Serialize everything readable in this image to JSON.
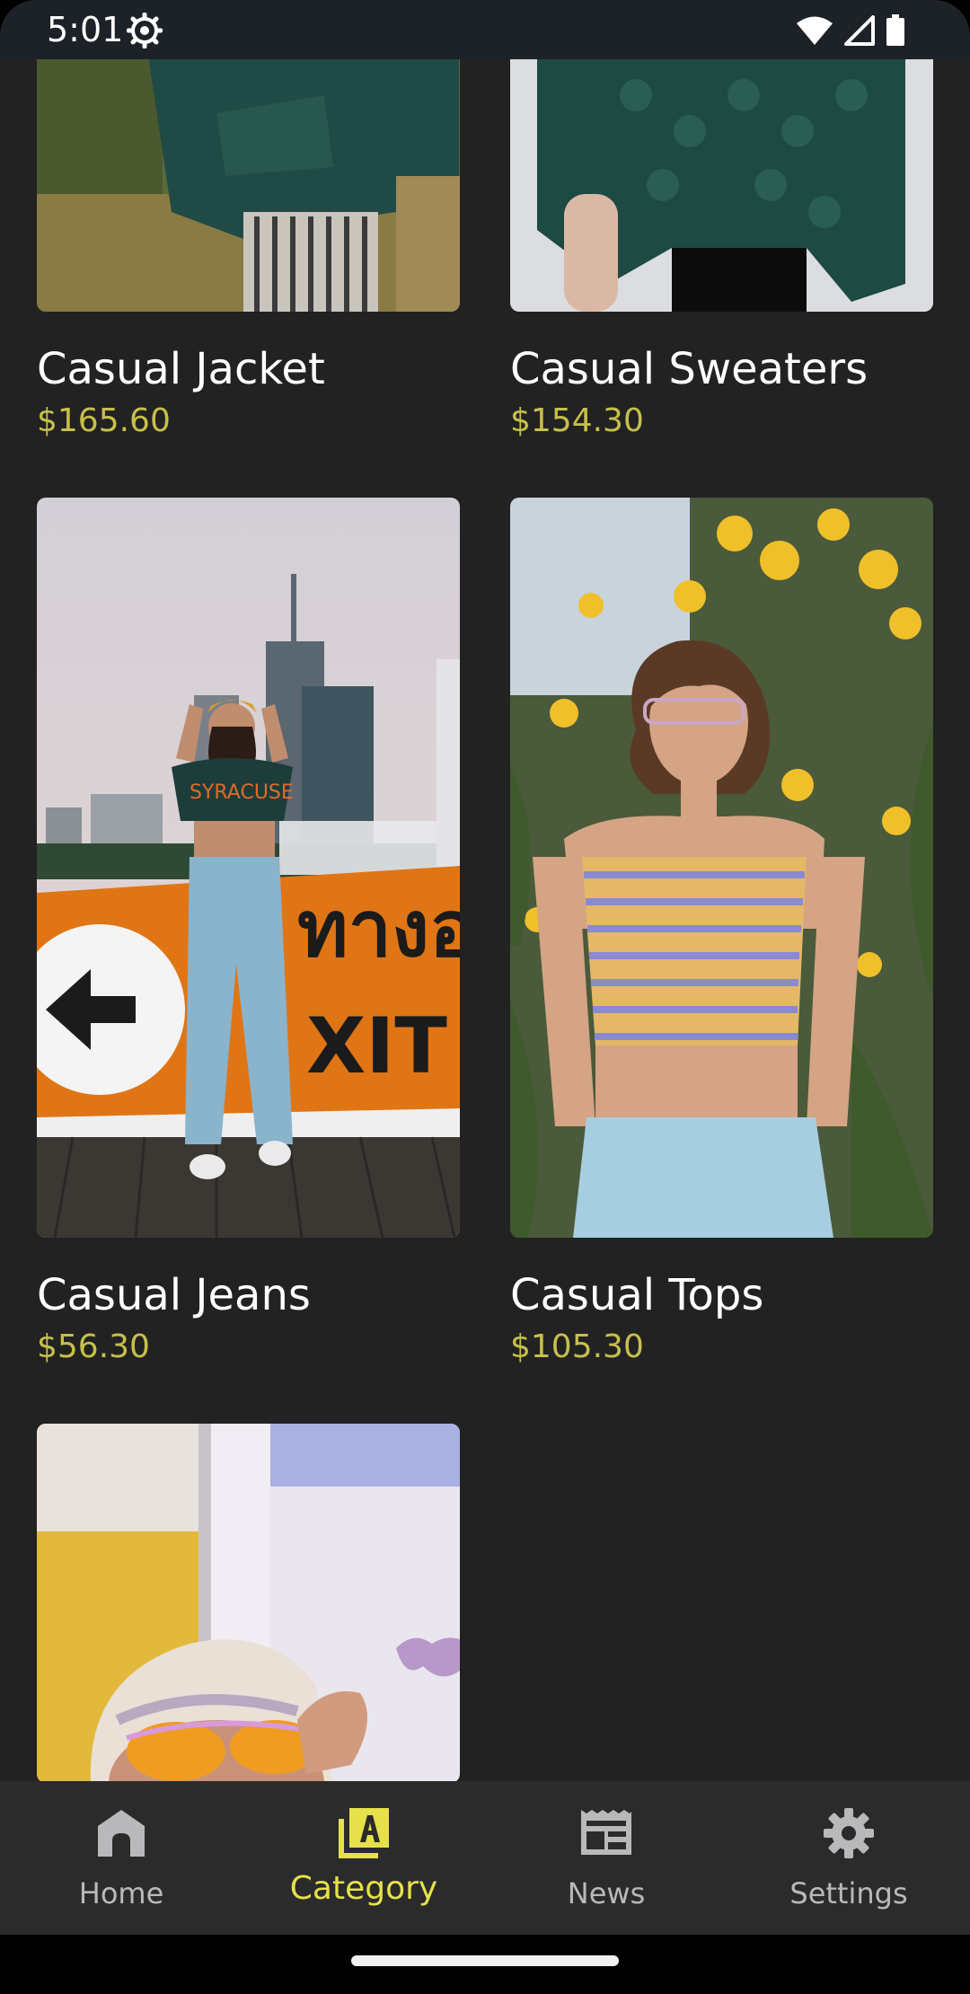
{
  "status_bar": {
    "time": "5:01",
    "icons": [
      "settings-gear-icon",
      "wifi-icon",
      "cell-signal-icon",
      "battery-icon"
    ]
  },
  "products": [
    {
      "title": "Casual Jacket",
      "price": "$165.60",
      "image": "green denim jacket photo"
    },
    {
      "title": "Casual Sweaters",
      "price": "$154.30",
      "image": "green knit sweater photo"
    },
    {
      "title": "Casual Jeans",
      "price": "$56.30",
      "image": "woman in jeans by exit sign photo"
    },
    {
      "title": "Casual Tops",
      "price": "$105.30",
      "image": "woman in striped crop top photo"
    },
    {
      "title": "",
      "price": "",
      "image": "woman in beret with sunglasses photo"
    }
  ],
  "bottom_nav": {
    "items": [
      {
        "label": "Home",
        "icon": "home-icon",
        "active": false
      },
      {
        "label": "Category",
        "icon": "category-icon",
        "active": true
      },
      {
        "label": "News",
        "icon": "news-icon",
        "active": false
      },
      {
        "label": "Settings",
        "icon": "settings-icon",
        "active": false
      }
    ]
  },
  "colors": {
    "background": "#222223",
    "price": "#c7c04a",
    "active_nav": "#e6e14a",
    "inactive_nav": "#b9b9bb",
    "nav_background": "#2b2b2c",
    "status_bar": "#1d2228"
  }
}
